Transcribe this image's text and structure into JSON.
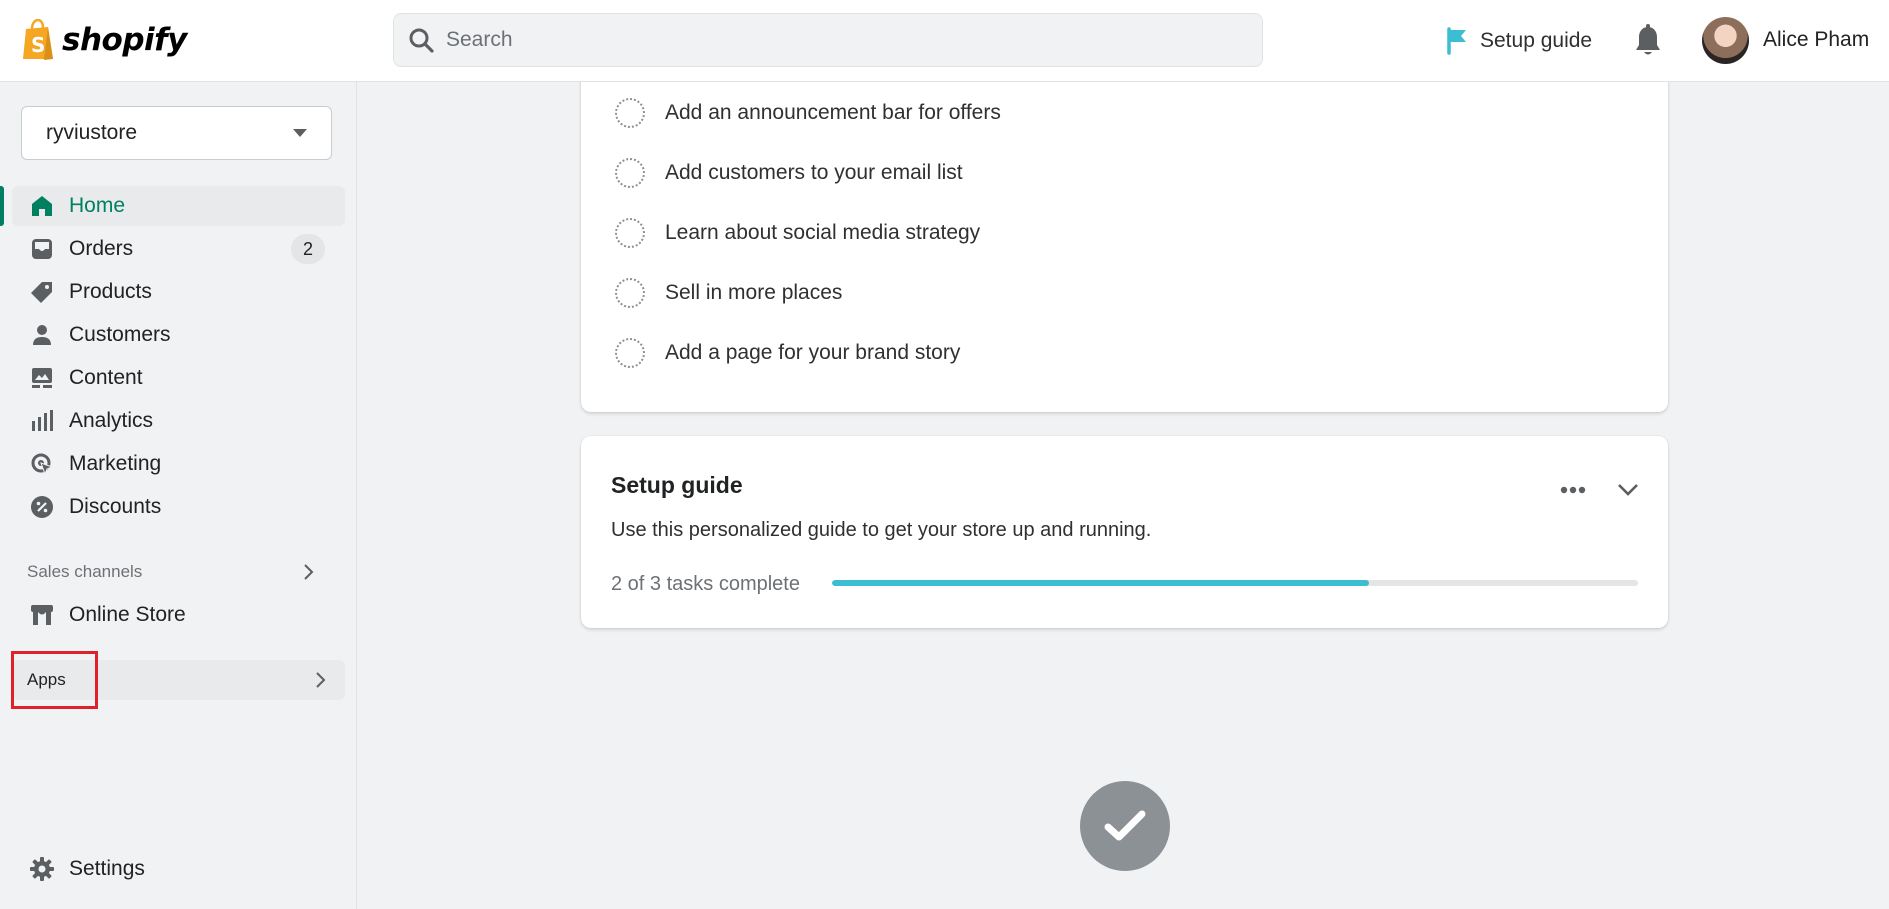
{
  "header": {
    "brand": "shopify",
    "search": {
      "placeholder": "Search",
      "value": ""
    },
    "setup_guide_label": "Setup guide",
    "user_name": "Alice Pham"
  },
  "sidebar": {
    "store_name": "ryviustore",
    "items": [
      {
        "label": "Home",
        "icon": "home-icon",
        "active": true
      },
      {
        "label": "Orders",
        "icon": "orders-icon",
        "badge": "2"
      },
      {
        "label": "Products",
        "icon": "tag-icon"
      },
      {
        "label": "Customers",
        "icon": "person-icon"
      },
      {
        "label": "Content",
        "icon": "image-icon"
      },
      {
        "label": "Analytics",
        "icon": "bar-chart-icon"
      },
      {
        "label": "Marketing",
        "icon": "target-icon"
      },
      {
        "label": "Discounts",
        "icon": "discount-icon"
      }
    ],
    "sales_channels": {
      "label": "Sales channels",
      "items": [
        {
          "label": "Online Store",
          "icon": "store-icon"
        }
      ]
    },
    "apps": {
      "label": "Apps"
    },
    "settings": {
      "label": "Settings",
      "icon": "gear-icon"
    }
  },
  "main": {
    "tasks": [
      {
        "label": "Add an announcement bar for offers",
        "done": false
      },
      {
        "label": "Add customers to your email list",
        "done": false
      },
      {
        "label": "Learn about social media strategy",
        "done": false
      },
      {
        "label": "Sell in more places",
        "done": false
      },
      {
        "label": "Add a page for your brand story",
        "done": false
      }
    ],
    "setup_guide": {
      "title": "Setup guide",
      "description": "Use this personalized guide to get your store up and running.",
      "progress_text": "2 of 3 tasks complete",
      "completed": 2,
      "total": 3,
      "progress_color": "#3bbdd2"
    }
  },
  "colors": {
    "brand_green": "#008060",
    "highlight_red": "#e0202b",
    "shopify_bag": "#f5a623"
  }
}
